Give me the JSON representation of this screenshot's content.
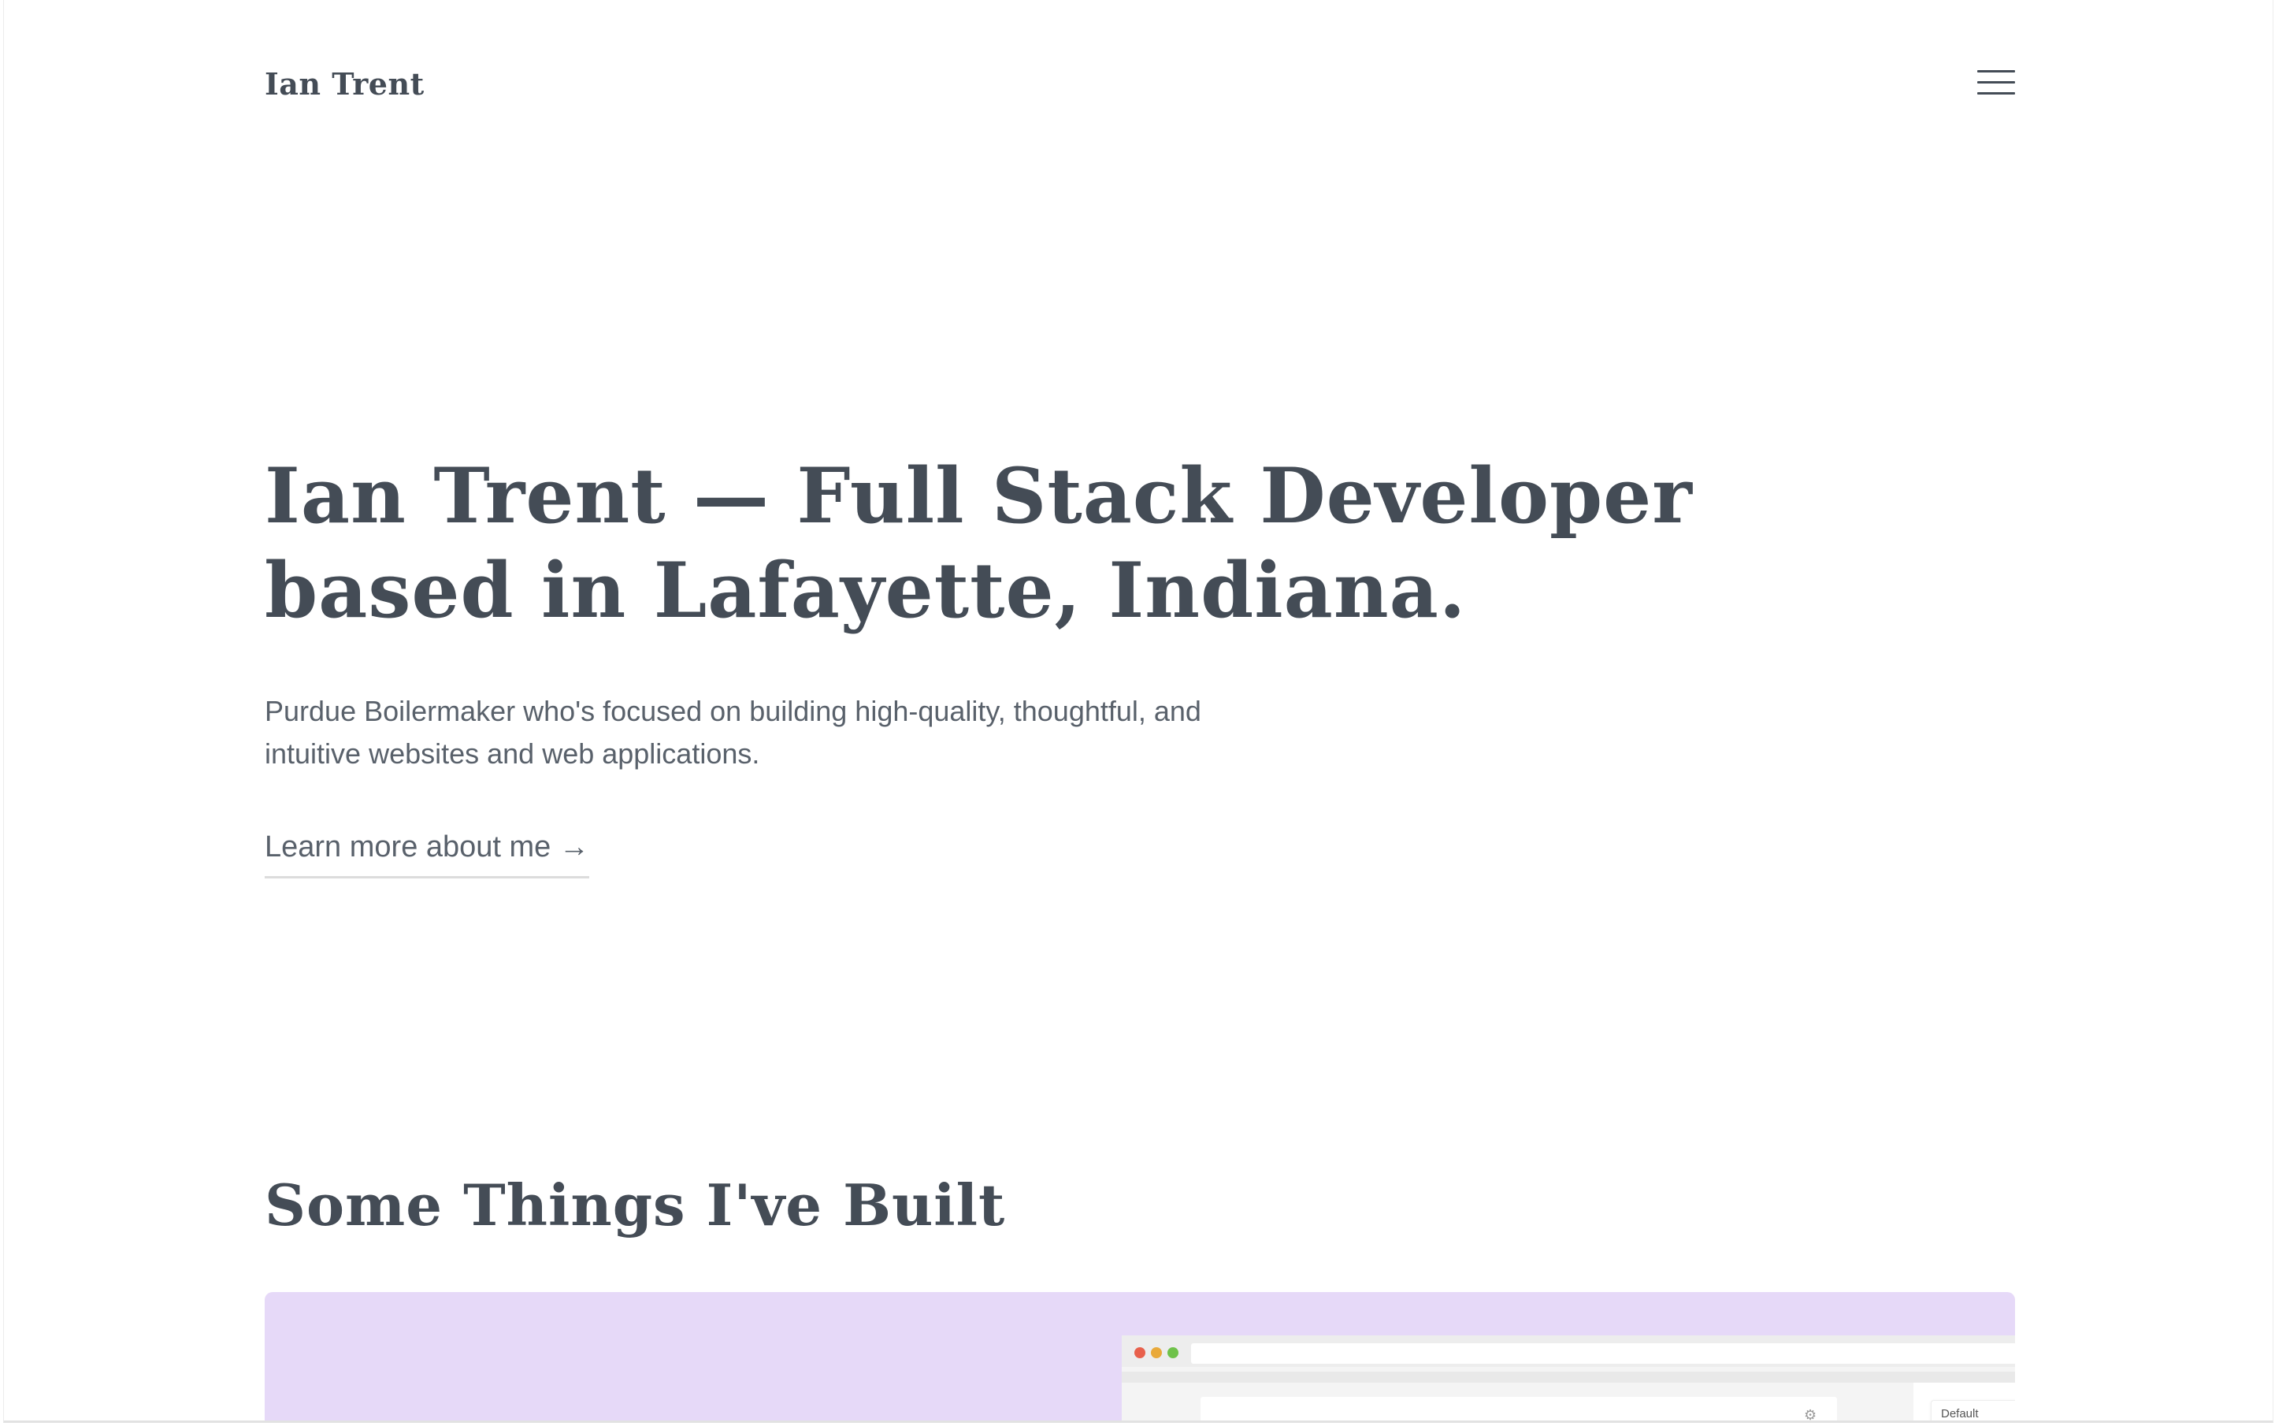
{
  "header": {
    "logo_text": "Ian Trent",
    "menu_icon": "hamburger-menu-icon"
  },
  "hero": {
    "title": "Ian Trent — Full Stack Developer based in Lafayette, Indiana.",
    "subtitle": "Purdue Boilermaker who's focused on building high-quality, thoughtful, and intuitive websites and web applications.",
    "cta_label": "Learn more about me →"
  },
  "projects": {
    "section_title": "Some Things I've Built",
    "card_background": "#e6d9f8",
    "preview": {
      "window_dots": [
        "#e8604c",
        "#e9a93a",
        "#6fc24a"
      ],
      "settings_icon": "gear-icon",
      "dropdown_label": "Default"
    }
  },
  "colors": {
    "text_primary": "#444c56",
    "text_secondary": "#59616b",
    "background": "#ffffff"
  }
}
